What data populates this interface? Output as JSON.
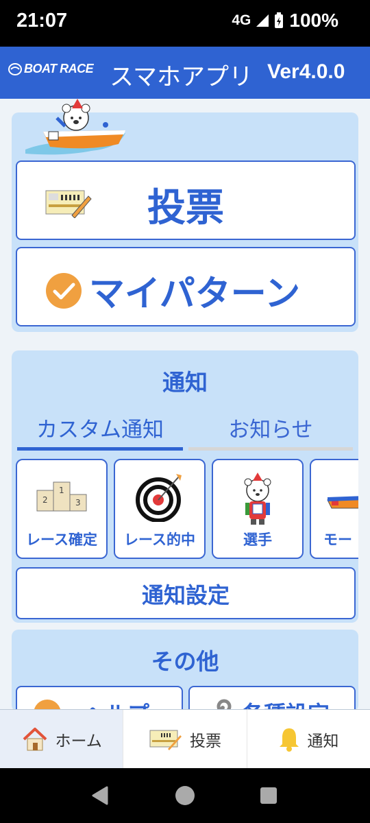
{
  "status_bar": {
    "time": "21:07",
    "network": "4G",
    "battery": "100%"
  },
  "app_bar": {
    "logo": "BOAT RACE",
    "title": "スマホアプリ",
    "version": "Ver4.0.0"
  },
  "main_menu": {
    "vote_label": "投票",
    "mypattern_label": "マイパターン"
  },
  "notification_section": {
    "title": "通知",
    "tabs": [
      {
        "label": "カスタム通知",
        "active": true
      },
      {
        "label": "お知らせ",
        "active": false
      }
    ],
    "categories": [
      {
        "label": "レース確定",
        "icon": "podium-icon"
      },
      {
        "label": "レース的中",
        "icon": "target-icon"
      },
      {
        "label": "選手",
        "icon": "mascot-player-icon"
      },
      {
        "label": "モー",
        "icon": "motor-icon"
      }
    ],
    "settings_label": "通知設定"
  },
  "other_section": {
    "title": "その他",
    "help_label": "ヘルプ",
    "settings_label": "各種設定"
  },
  "bottom_nav": {
    "items": [
      {
        "label": "ホーム",
        "icon": "home-icon",
        "active": true
      },
      {
        "label": "投票",
        "icon": "ticket-icon",
        "active": false
      },
      {
        "label": "通知",
        "icon": "bell-icon",
        "active": false
      }
    ]
  },
  "colors": {
    "primary": "#2f63d2",
    "panel": "#c8e1f9",
    "accent_orange": "#f0a040"
  }
}
